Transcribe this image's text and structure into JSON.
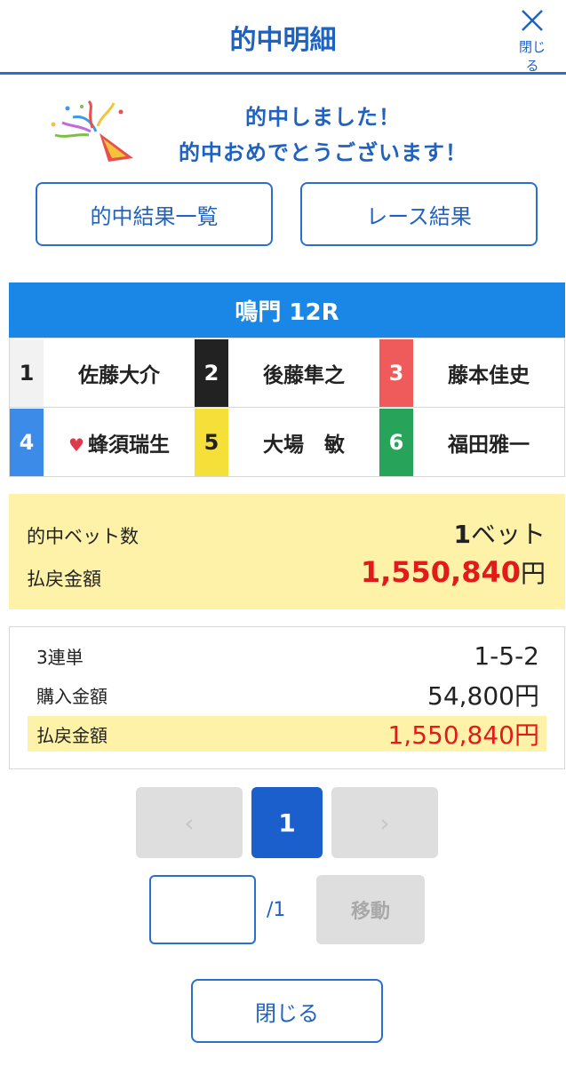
{
  "header": {
    "title": "的中明細",
    "close_label": "閉じる"
  },
  "congrats": {
    "line1": "的中しました！",
    "line2": "的中おめでとうございます！"
  },
  "buttons": {
    "results_list": "的中結果一覧",
    "race_results": "レース結果"
  },
  "race": {
    "title": "鳴門 12R"
  },
  "racers": [
    {
      "number": "1",
      "name": "佐藤大介",
      "color": "#f2f2f2",
      "text_color": "#222222",
      "favorite": false
    },
    {
      "number": "2",
      "name": "後藤隼之",
      "color": "#222222",
      "text_color": "#ffffff",
      "favorite": false
    },
    {
      "number": "3",
      "name": "藤本佳史",
      "color": "#ef5b5b",
      "text_color": "#ffffff",
      "favorite": false
    },
    {
      "number": "4",
      "name": "蜂須瑞生",
      "color": "#3d8be8",
      "text_color": "#ffffff",
      "favorite": true
    },
    {
      "number": "5",
      "name": "大場　敏",
      "color": "#f5e03a",
      "text_color": "#222222",
      "favorite": false
    },
    {
      "number": "6",
      "name": "福田雅一",
      "color": "#27a35a",
      "text_color": "#ffffff",
      "favorite": false
    }
  ],
  "summary": {
    "bets_label": "的中ベット数",
    "bets_count": "1",
    "bets_unit": "ベット",
    "payout_label": "払戻金額",
    "payout_value": "1,550,840",
    "yen": "円"
  },
  "detail": {
    "bet_type": "3連単",
    "combination": "1-5-2",
    "purchase_label": "購入金額",
    "purchase_value": "54,800円",
    "payout_label": "払戻金額",
    "payout_value": "1,550,840円"
  },
  "pagination": {
    "prev": "‹",
    "current": "1",
    "next": "›",
    "input_value": "",
    "total": "/1",
    "move_label": "移動"
  },
  "footer": {
    "close_label": "閉じる"
  }
}
